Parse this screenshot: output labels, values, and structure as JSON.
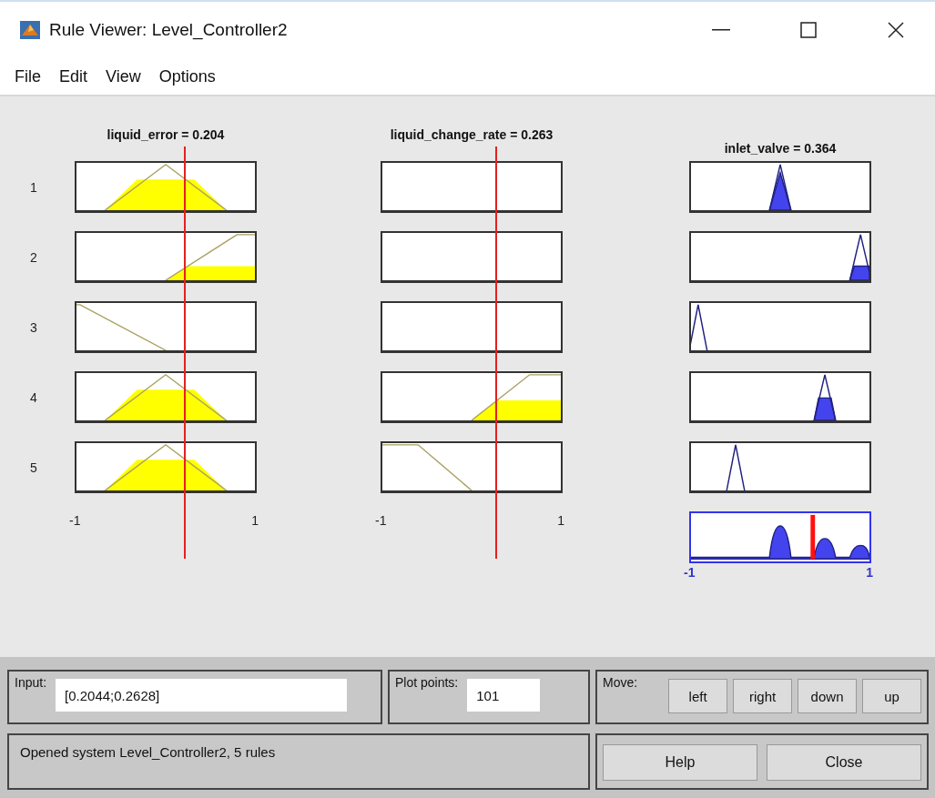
{
  "window": {
    "title": "Rule Viewer: Level_Controller2"
  },
  "menu": [
    {
      "label": "File"
    },
    {
      "label": "Edit"
    },
    {
      "label": "View"
    },
    {
      "label": "Options"
    }
  ],
  "rules": [
    "1",
    "2",
    "3",
    "4",
    "5"
  ],
  "inputs": [
    {
      "header": "liquid_error = 0.204",
      "axis_min": "-1",
      "axis_max": "1"
    },
    {
      "header": "liquid_change_rate = 0.263",
      "axis_min": "-1",
      "axis_max": "1"
    }
  ],
  "output": {
    "header": "inlet_valve = 0.364",
    "axis_min": "-1",
    "axis_max": "1"
  },
  "input_field": {
    "label": "Input:",
    "value": "[0.2044;0.2628]"
  },
  "plot_points": {
    "label": "Plot points:",
    "value": "101"
  },
  "move": {
    "label": "Move:",
    "buttons": [
      "left",
      "right",
      "down",
      "up"
    ]
  },
  "status": "Opened system Level_Controller2, 5 rules",
  "buttons": [
    "Help",
    "Close"
  ]
}
